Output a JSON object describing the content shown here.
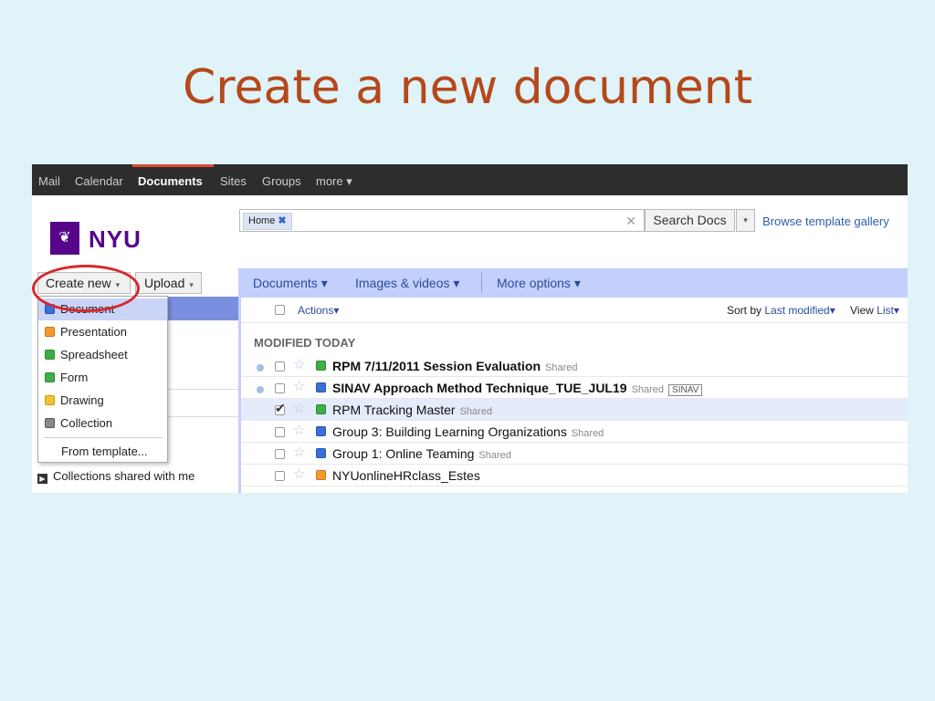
{
  "slide": {
    "title": "Create a new document"
  },
  "topbar": {
    "items": [
      "Mail",
      "Calendar",
      "Documents",
      "Sites",
      "Groups",
      "more ▾"
    ],
    "active": "Documents"
  },
  "header": {
    "logo_text": "NYU",
    "logo_glyph": "❦",
    "search_chip": "Home",
    "chip_x": "✖",
    "clear_x": "✕",
    "search_button": "Search Docs",
    "search_dropdown": "▾",
    "browse_link": "Browse template gallery"
  },
  "left": {
    "create_label": "Create new",
    "upload_label": "Upload",
    "caret": "▾",
    "shared_collections": "Collections shared with me",
    "shared_icon": "▶"
  },
  "dropdown": {
    "items": [
      {
        "label": "Document",
        "icon": "document-icon"
      },
      {
        "label": "Presentation",
        "icon": "presentation-icon"
      },
      {
        "label": "Spreadsheet",
        "icon": "spreadsheet-icon"
      },
      {
        "label": "Form",
        "icon": "form-icon"
      },
      {
        "label": "Drawing",
        "icon": "drawing-icon"
      },
      {
        "label": "Collection",
        "icon": "collection-icon"
      }
    ],
    "template": "From template..."
  },
  "toolbar": {
    "documents": "Documents ▾",
    "images": "Images & videos ▾",
    "more": "More options ▾"
  },
  "list": {
    "actions": "Actions▾",
    "sort_prefix": "Sort by",
    "sort_value": "Last modified▾",
    "view_prefix": "View",
    "view_value": "List▾",
    "section": "MODIFIED TODAY",
    "shared_word": "Shared",
    "rows": [
      {
        "name": "RPM 7/11/2011 Session Evaluation",
        "type": "form",
        "bold": true,
        "shared": "Shared",
        "label": ""
      },
      {
        "name": "SINAV Approach Method Technique_TUE_JUL19",
        "type": "doc",
        "bold": true,
        "shared": "Shared",
        "label": "SINAV"
      },
      {
        "name": "RPM Tracking Master",
        "type": "sheet",
        "bold": false,
        "shared": "Shared",
        "label": ""
      },
      {
        "name": "Group 3: Building Learning Organizations",
        "type": "doc",
        "bold": false,
        "shared": "Shared",
        "label": ""
      },
      {
        "name": "Group 1: Online Teaming",
        "type": "doc",
        "bold": false,
        "shared": "Shared",
        "label": ""
      },
      {
        "name": "NYUonlineHRclass_Estes",
        "type": "pres",
        "bold": false,
        "shared": "",
        "label": ""
      }
    ]
  },
  "colors": {
    "title": "#b5481b",
    "topbar": "#2d2d2d",
    "accent_blue": "#c3d0fb",
    "nyu_purple": "#57068c",
    "highlight_red": "#d6282e"
  }
}
